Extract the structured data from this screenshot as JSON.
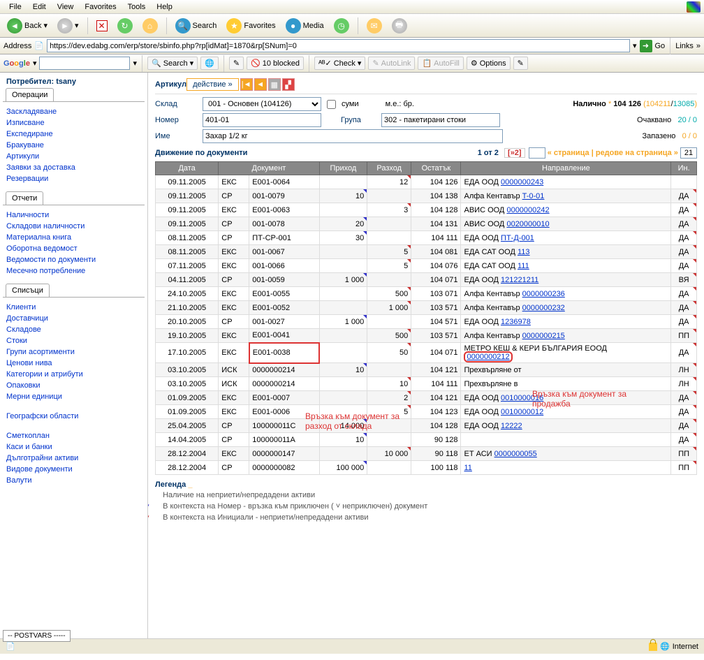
{
  "browser": {
    "menu": [
      "File",
      "Edit",
      "View",
      "Favorites",
      "Tools",
      "Help"
    ],
    "back": "Back",
    "search": "Search",
    "favorites": "Favorites",
    "media": "Media",
    "address_label": "Address",
    "url": "https://dev.edabg.com/erp/store/sbinfo.php?rp[idMat]=1870&rp[SNum]=0",
    "go": "Go",
    "links": "Links"
  },
  "google": {
    "search": "Search",
    "blocked": "10 blocked",
    "check": "Check",
    "autolink": "AutoLink",
    "autofill": "AutoFill",
    "options": "Options"
  },
  "sidebar": {
    "user_label": "Потребител: tsany",
    "tab_ops": "Операции",
    "ops": [
      "Заскладяване",
      "Изписване",
      "Експедиране",
      "Бракуване",
      "Артикули",
      "Заявки за доставка",
      "Резервации"
    ],
    "tab_reports": "Отчети",
    "reports": [
      "Наличности",
      "Складови наличности",
      "Материална книга",
      "Оборотна ведомост",
      "Ведомости по документи",
      "Месечно потребление"
    ],
    "tab_lists": "Списъци",
    "lists": [
      "Клиенти",
      "Доставчици",
      "Складове",
      "Стоки",
      "Групи асортименти",
      "Ценови нива",
      "Категории и атрибути",
      "Опаковки",
      "Мерни единици",
      "",
      "Географски области",
      "",
      "Сметкоплан",
      "Каси и банки",
      "Дълготрайни активи",
      "Видове документи",
      "Валути"
    ]
  },
  "header": {
    "title": "Артикул",
    "action": "действие »",
    "sklad_label": "Склад",
    "sklad_value": "001 - Основен (104126)",
    "sumi": "суми",
    "me": "м.е.: бр.",
    "nalichno": "Налично",
    "nalichno_val": "104 126",
    "nalichno_extra": "(104211/13085)",
    "nomer_label": "Номер",
    "nomer_value": "401-01",
    "grupa_label": "Група",
    "grupa_value": "302 - пакетирани стоки",
    "ochakvano": "Очаквано",
    "ochakvano_val": "20 / 0",
    "ime_label": "Име",
    "ime_value": "Захар 1/2 кг",
    "zapazeno": "Запазено",
    "zapazeno_val": "0 / 0"
  },
  "section": {
    "title": "Движение по документи",
    "page_of": "1 от 2",
    "next": "[»2]",
    "pager_text": "« страница | редове на страница »",
    "rows": "21"
  },
  "columns": [
    "Дата",
    "Документ",
    "Приход",
    "Разход",
    "Остатък",
    "Направление",
    "Ин."
  ],
  "rows": [
    {
      "d": "09.11.2005",
      "t": "ЕКС",
      "doc": "E001-0064",
      "in": "",
      "out": "12",
      "bal": "104 126",
      "dir": "ЕДА ООД",
      "dl": "0000000243",
      "ini": ""
    },
    {
      "d": "09.11.2005",
      "t": "СР",
      "doc": "001-0079",
      "in": "10",
      "out": "",
      "bal": "104 138",
      "dir": "Алфа Кентавър",
      "dl": "T-0-01",
      "ini": "ДА"
    },
    {
      "d": "09.11.2005",
      "t": "ЕКС",
      "doc": "E001-0063",
      "in": "",
      "out": "3",
      "bal": "104 128",
      "dir": "АВИС ООД",
      "dl": "0000000242",
      "ini": "ДА"
    },
    {
      "d": "09.11.2005",
      "t": "СР",
      "doc": "001-0078",
      "in": "20",
      "out": "",
      "bal": "104 131",
      "dir": "АВИС ООД",
      "dl": "0020000010",
      "ini": "ДА"
    },
    {
      "d": "08.11.2005",
      "t": "СР",
      "doc": "ПТ-СР-001",
      "in": "30",
      "out": "",
      "bal": "104 111",
      "dir": "ЕДА ООД",
      "dl": "ПТ-Д-001",
      "ini": "ДА"
    },
    {
      "d": "08.11.2005",
      "t": "ЕКС",
      "doc": "001-0067",
      "in": "",
      "out": "5",
      "bal": "104 081",
      "dir": "ЕДА САТ ООД",
      "dl": "113",
      "ini": "ДА"
    },
    {
      "d": "07.11.2005",
      "t": "ЕКС",
      "doc": "001-0066",
      "in": "",
      "out": "5",
      "bal": "104 076",
      "dir": "ЕДА САТ ООД",
      "dl": "111",
      "ini": "ДА"
    },
    {
      "d": "04.11.2005",
      "t": "СР",
      "doc": "001-0059",
      "in": "1 000",
      "out": "",
      "bal": "104 071",
      "dir": "ЕДА ООД",
      "dl": "121221211",
      "ini": "ВЯ"
    },
    {
      "d": "24.10.2005",
      "t": "ЕКС",
      "doc": "E001-0055",
      "in": "",
      "out": "500",
      "bal": "103 071",
      "dir": "Алфа Кентавър",
      "dl": "0000000236",
      "ini": "ДА"
    },
    {
      "d": "21.10.2005",
      "t": "ЕКС",
      "doc": "E001-0052",
      "in": "",
      "out": "1 000",
      "bal": "103 571",
      "dir": "Алфа Кентавър",
      "dl": "0000000232",
      "ini": "ДА"
    },
    {
      "d": "20.10.2005",
      "t": "СР",
      "doc": "001-0027",
      "in": "1 000",
      "out": "",
      "bal": "104 571",
      "dir": "ЕДА ООД",
      "dl": "1236978",
      "ini": "ДА"
    },
    {
      "d": "19.10.2005",
      "t": "ЕКС",
      "doc": "E001-0041",
      "in": "",
      "out": "500",
      "bal": "103 571",
      "dir": "Алфа Кентавър",
      "dl": "0000000215",
      "ini": "ПП"
    },
    {
      "d": "17.10.2005",
      "t": "ЕКС",
      "doc": "E001-0038",
      "in": "",
      "out": "50",
      "bal": "104 071",
      "dir": "МЕТРО КЕШ & КЕРИ БЪЛГАРИЯ ЕООД",
      "dl": "0000000212",
      "ini": "ДА",
      "hl": true,
      "two": true
    },
    {
      "d": "03.10.2005",
      "t": "ИСК",
      "doc": "0000000214",
      "in": "10",
      "out": "",
      "bal": "104 121",
      "dir": "Прехвърляне от",
      "dl": "",
      "ini": "ЛН"
    },
    {
      "d": "03.10.2005",
      "t": "ИСК",
      "doc": "0000000214",
      "in": "",
      "out": "10",
      "bal": "104 111",
      "dir": "Прехвърляне в",
      "dl": "",
      "ini": "ЛН"
    },
    {
      "d": "01.09.2005",
      "t": "ЕКС",
      "doc": "E001-0007",
      "in": "",
      "out": "2",
      "bal": "104 121",
      "dir": "ЕДА ООД",
      "dl": "0010000016",
      "ini": "ДА"
    },
    {
      "d": "01.09.2005",
      "t": "ЕКС",
      "doc": "E001-0006",
      "in": "",
      "out": "5",
      "bal": "104 123",
      "dir": "ЕДА ООД",
      "dl": "0010000012",
      "ini": "ДА"
    },
    {
      "d": "25.04.2005",
      "t": "СР",
      "doc": "100000011C",
      "in": "14 000",
      "out": "",
      "bal": "104 128",
      "dir": "ЕДА ООД",
      "dl": "12222",
      "ini": "ДА"
    },
    {
      "d": "14.04.2005",
      "t": "СР",
      "doc": "100000011A",
      "in": "10",
      "out": "",
      "bal": "90 128",
      "dir": "",
      "dl": "",
      "ini": "ДА"
    },
    {
      "d": "28.12.2004",
      "t": "ЕКС",
      "doc": "0000000147",
      "in": "",
      "out": "10 000",
      "bal": "90 118",
      "dir": "ЕТ АСИ",
      "dl": "0000000055",
      "ini": "ПП"
    },
    {
      "d": "28.12.2004",
      "t": "СР",
      "doc": "0000000082",
      "in": "100 000",
      "out": "",
      "bal": "100 118",
      "dir": "",
      "dl": "11",
      "ini": "ПП"
    }
  ],
  "legend": {
    "title": "Легенда",
    "items": [
      "Наличие на неприети/непредадени активи",
      "В контекста на Номер - връзка към приключен ( ˅ неприключен) документ",
      "В контекста на Инициали - неприети/непредадени активи"
    ]
  },
  "annotations": {
    "a1": "Връзка към документ за разход от склада",
    "a2": "Връзка към документ за продажба"
  },
  "status": {
    "internet": "Internet"
  },
  "postvars": "-- POSTVARS -----"
}
